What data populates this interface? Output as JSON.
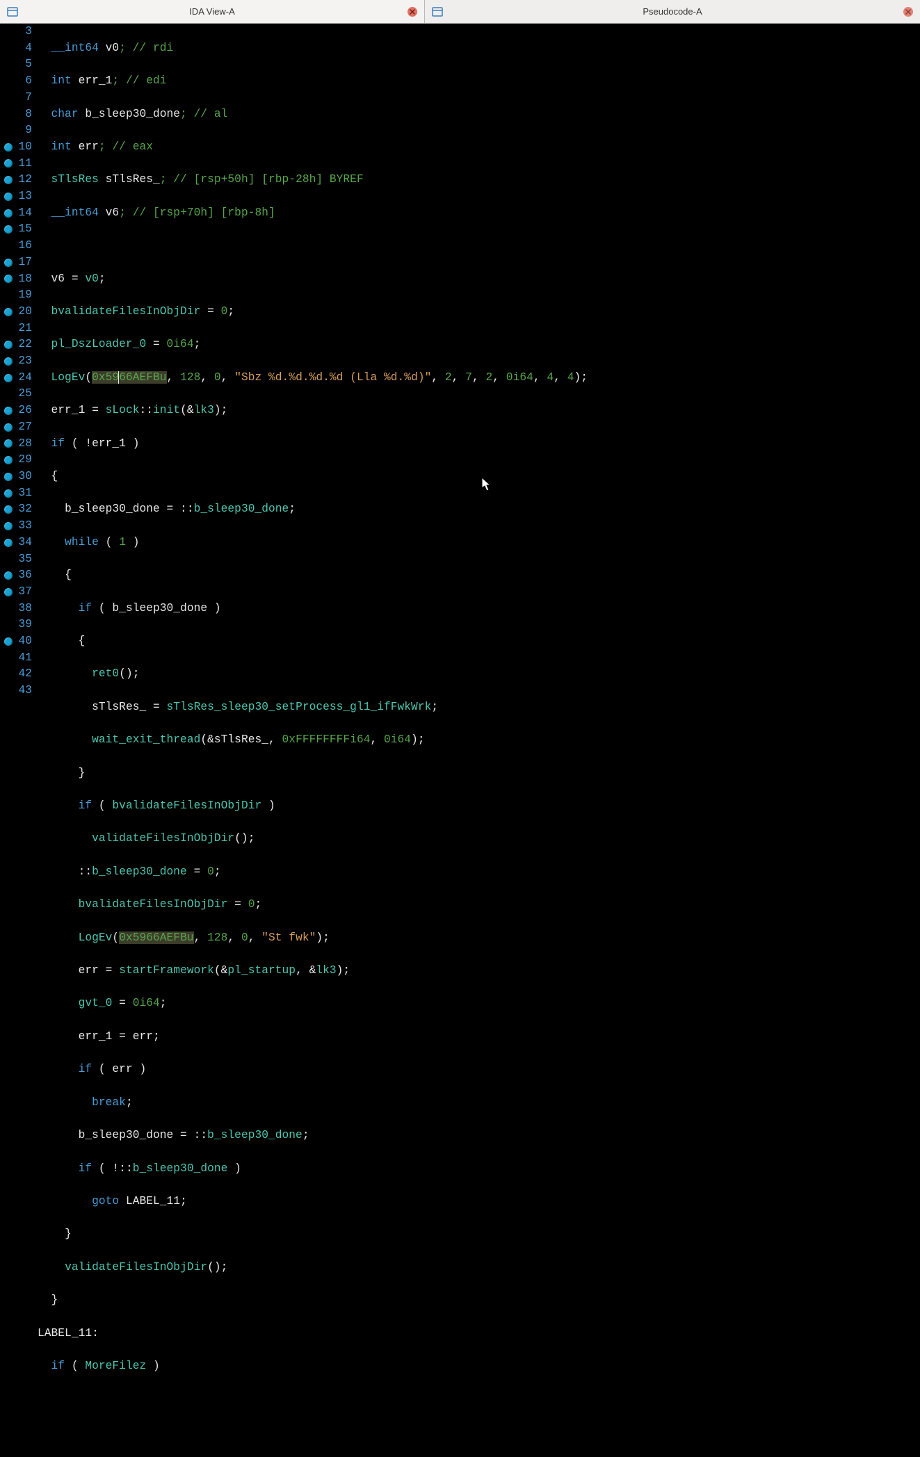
{
  "tabs": {
    "left": {
      "label": "IDA View-A"
    },
    "right": {
      "label": "Pseudocode-A"
    }
  },
  "gutter": {
    "start": 3,
    "end": 43,
    "breakpoints": [
      10,
      11,
      12,
      13,
      14,
      15,
      17,
      18,
      20,
      22,
      23,
      24,
      26,
      27,
      28,
      29,
      30,
      31,
      32,
      33,
      34,
      36,
      37,
      40
    ]
  },
  "code": {
    "l3": {
      "type": "__int64",
      "name": " v0",
      "cmt": "; // rdi"
    },
    "l4": {
      "type": "int",
      "name": " err_1",
      "cmt": "; // edi"
    },
    "l5": {
      "type": "char",
      "name": " b_sleep30_done",
      "cmt": "; // al"
    },
    "l6": {
      "type": "int",
      "name": " err",
      "cmt": "; // eax"
    },
    "l7": {
      "type": "sTlsRes",
      "name": " sTlsRes_",
      "cmt": "; // [rsp+50h] [rbp-28h] BYREF"
    },
    "l8": {
      "type": "__int64",
      "name": " v6",
      "cmt": "; // [rsp+70h] [rbp-8h]"
    },
    "l10": {
      "lhs": "v6",
      "op": " = ",
      "rhs": "v0",
      "semi": ";"
    },
    "l11": {
      "lhs": "bvalidateFilesInObjDir",
      "op": " = ",
      "rhs": "0",
      "semi": ";"
    },
    "l12": {
      "lhs": "pl_DszLoader_0",
      "op": " = ",
      "rhs": "0i64",
      "semi": ";"
    },
    "l13": {
      "fn": "LogEv",
      "open": "(",
      "hex": "0x5966AEFBu",
      "args_a": ", ",
      "n128": "128",
      "c1": ", ",
      "n0": "0",
      "c2": ", ",
      "str": "\"Sbz %d.%d.%d.%d (Lla %d.%d)\"",
      "c3": ", ",
      "n2": "2",
      "c4": ", ",
      "n7": "7",
      "c5": ", ",
      "n2b": "2",
      "c6": ", ",
      "n0i": "0i64",
      "c7": ", ",
      "n4": "4",
      "c8": ", ",
      "n4b": "4",
      "close": ");"
    },
    "l14": {
      "lhs": "err_1",
      "op": " = ",
      "cls": "sLock",
      "dcol": "::",
      "fn": "init",
      "open": "(&",
      "arg": "lk3",
      "close": ");"
    },
    "l15": {
      "if": "if",
      "open": " ( !",
      "var": "err_1",
      "close": " )"
    },
    "l16": {
      "brace": "{"
    },
    "l17": {
      "lhs": "b_sleep30_done",
      "op": " = ::",
      "rhs": "b_sleep30_done",
      "semi": ";"
    },
    "l18": {
      "kw": "while",
      "open": " ( ",
      "n": "1",
      "close": " )"
    },
    "l19": {
      "brace": "{"
    },
    "l20": {
      "if": "if",
      "open": " ( ",
      "var": "b_sleep30_done",
      "close": " )"
    },
    "l21": {
      "brace": "{"
    },
    "l22": {
      "fn": "ret0",
      "rest": "();"
    },
    "l23": {
      "lhs": "sTlsRes_",
      "op": " = ",
      "rhs": "sTlsRes_sleep30_setProcess_gl1_ifFwkWrk",
      "semi": ";"
    },
    "l24": {
      "fn": "wait_exit_thread",
      "open": "(&",
      "arg1": "sTlsRes_",
      "c1": ", ",
      "hex": "0xFFFFFFFFi64",
      "c2": ", ",
      "n0": "0i64",
      "close": ");"
    },
    "l25": {
      "brace": "}"
    },
    "l26": {
      "if": "if",
      "open": " ( ",
      "var": "bvalidateFilesInObjDir",
      "close": " )"
    },
    "l27": {
      "fn": "validateFilesInObjDir",
      "rest": "();"
    },
    "l28": {
      "pre": "::",
      "lhs": "b_sleep30_done",
      "op": " = ",
      "rhs": "0",
      "semi": ";"
    },
    "l29": {
      "lhs": "bvalidateFilesInObjDir",
      "op": " = ",
      "rhs": "0",
      "semi": ";"
    },
    "l30": {
      "fn": "LogEv",
      "open": "(",
      "hex": "0x5966AEFBu",
      "c1": ", ",
      "n128": "128",
      "c2": ", ",
      "n0": "0",
      "c3": ", ",
      "str": "\"St fwk\"",
      "close": ");"
    },
    "l31": {
      "lhs": "err",
      "op": " = ",
      "fn": "startFramework",
      "open": "(&",
      "a1": "pl_startup",
      "c1": ", &",
      "a2": "lk3",
      "close": ");"
    },
    "l32": {
      "lhs": "gvt_0",
      "op": " = ",
      "rhs": "0i64",
      "semi": ";"
    },
    "l33": {
      "lhs": "err_1",
      "op": " = ",
      "rhs": "err",
      "semi": ";"
    },
    "l34": {
      "if": "if",
      "open": " ( ",
      "var": "err",
      "close": " )"
    },
    "l35": {
      "kw": "break",
      "semi": ";"
    },
    "l36": {
      "lhs": "b_sleep30_done",
      "op": " = ::",
      "rhs": "b_sleep30_done",
      "semi": ";"
    },
    "l37": {
      "if": "if",
      "open": " ( !::",
      "var": "b_sleep30_done",
      "close": " )"
    },
    "l38": {
      "kw": "goto",
      "lbl": " LABEL_11",
      "semi": ";"
    },
    "l39": {
      "brace": "}"
    },
    "l40": {
      "fn": "validateFilesInObjDir",
      "rest": "();"
    },
    "l41": {
      "brace": "}"
    },
    "l42": {
      "lbl": "LABEL_11:"
    },
    "l43": {
      "if": "if",
      "open": " ( ",
      "var": "MoreFilez",
      "close": " )"
    }
  }
}
